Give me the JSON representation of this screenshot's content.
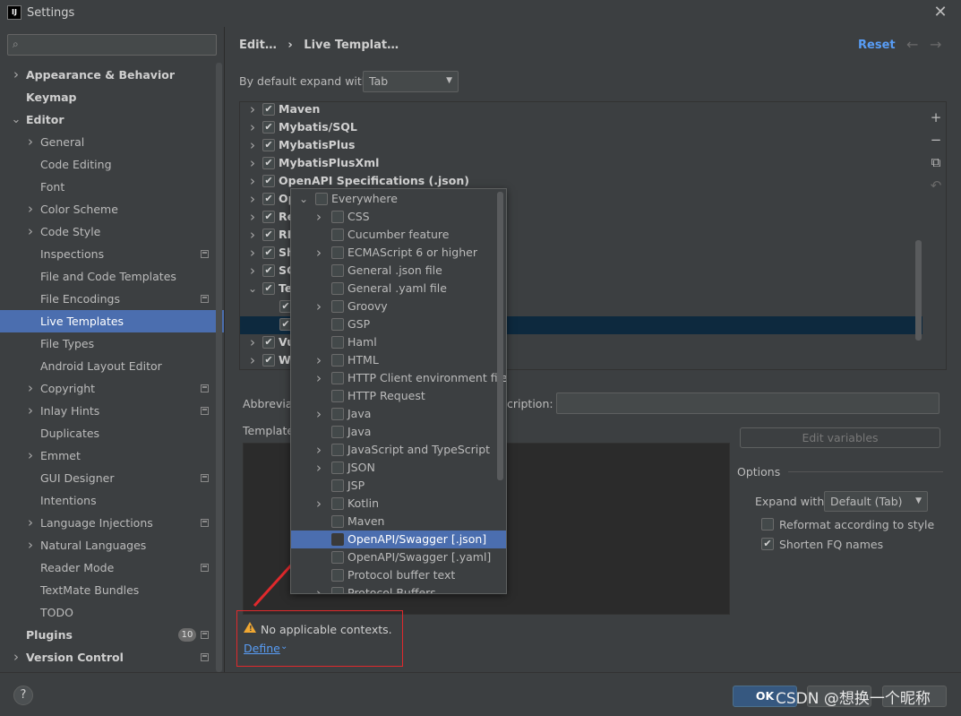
{
  "window": {
    "title": "Settings",
    "app_icon_text": "IJ"
  },
  "search": {
    "placeholder": "",
    "icon": "search-icon"
  },
  "sidebar": {
    "items": [
      {
        "label": "Appearance & Behavior",
        "level": 0,
        "bold": true,
        "chevron": "right"
      },
      {
        "label": "Keymap",
        "level": 0,
        "bold": true,
        "chevron": ""
      },
      {
        "label": "Editor",
        "level": 0,
        "bold": true,
        "chevron": "down"
      },
      {
        "label": "General",
        "level": 1,
        "chevron": "right"
      },
      {
        "label": "Code Editing",
        "level": 1,
        "chevron": ""
      },
      {
        "label": "Font",
        "level": 1,
        "chevron": ""
      },
      {
        "label": "Color Scheme",
        "level": 1,
        "chevron": "right"
      },
      {
        "label": "Code Style",
        "level": 1,
        "chevron": "right"
      },
      {
        "label": "Inspections",
        "level": 1,
        "chevron": "",
        "marker": true
      },
      {
        "label": "File and Code Templates",
        "level": 1,
        "chevron": ""
      },
      {
        "label": "File Encodings",
        "level": 1,
        "chevron": "",
        "marker": true
      },
      {
        "label": "Live Templates",
        "level": 1,
        "chevron": "",
        "selected": true
      },
      {
        "label": "File Types",
        "level": 1,
        "chevron": ""
      },
      {
        "label": "Android Layout Editor",
        "level": 1,
        "chevron": ""
      },
      {
        "label": "Copyright",
        "level": 1,
        "chevron": "right",
        "marker": true
      },
      {
        "label": "Inlay Hints",
        "level": 1,
        "chevron": "right",
        "marker": true
      },
      {
        "label": "Duplicates",
        "level": 1,
        "chevron": ""
      },
      {
        "label": "Emmet",
        "level": 1,
        "chevron": "right"
      },
      {
        "label": "GUI Designer",
        "level": 1,
        "chevron": "",
        "marker": true
      },
      {
        "label": "Intentions",
        "level": 1,
        "chevron": ""
      },
      {
        "label": "Language Injections",
        "level": 1,
        "chevron": "right",
        "marker": true
      },
      {
        "label": "Natural Languages",
        "level": 1,
        "chevron": "right"
      },
      {
        "label": "Reader Mode",
        "level": 1,
        "chevron": "",
        "marker": true
      },
      {
        "label": "TextMate Bundles",
        "level": 1,
        "chevron": ""
      },
      {
        "label": "TODO",
        "level": 1,
        "chevron": ""
      },
      {
        "label": "Plugins",
        "level": 0,
        "bold": true,
        "chevron": "",
        "badge": "10",
        "marker": true
      },
      {
        "label": "Version Control",
        "level": 0,
        "bold": true,
        "chevron": "right",
        "marker": true
      }
    ]
  },
  "header": {
    "breadcrumb_1": "Edit…",
    "breadcrumb_sep": "›",
    "breadcrumb_2": "Live Templat…",
    "reset": "Reset",
    "back_arrow": "←",
    "forward_arrow": "→"
  },
  "expand": {
    "label": "By default expand with",
    "value": "Tab"
  },
  "template_groups": [
    {
      "label": "Maven",
      "checked": true,
      "chevron": "right"
    },
    {
      "label": "Mybatis/SQL",
      "checked": true,
      "chevron": "right"
    },
    {
      "label": "MybatisPlus",
      "checked": true,
      "chevron": "right"
    },
    {
      "label": "MybatisPlusXml",
      "checked": true,
      "chevron": "right"
    },
    {
      "label": "OpenAPI Specifications (.json)",
      "checked": true,
      "chevron": "right"
    },
    {
      "label": "Op",
      "checked": true,
      "chevron": "right"
    },
    {
      "label": "Re",
      "checked": true,
      "chevron": "right"
    },
    {
      "label": "RE",
      "checked": true,
      "chevron": "right"
    },
    {
      "label": "Sh",
      "checked": true,
      "chevron": "right"
    },
    {
      "label": "SC",
      "checked": true,
      "chevron": "right"
    },
    {
      "label": "Te",
      "checked": true,
      "chevron": "down"
    },
    {
      "label": "",
      "checked": true,
      "chevron": "",
      "indent": true
    },
    {
      "label": "",
      "checked": true,
      "chevron": "",
      "indent": true,
      "selected": true
    },
    {
      "label": "Vu",
      "checked": true,
      "chevron": "right"
    },
    {
      "label": "W",
      "checked": true,
      "chevron": "right"
    }
  ],
  "tools": {
    "add": "+",
    "remove": "−",
    "copy": "⧉",
    "restore": "↶"
  },
  "form": {
    "abbreviation_label": "Abbreviat",
    "description_label": "cription:",
    "description_value": "",
    "template_text_label": "Template",
    "edit_variables": "Edit variables"
  },
  "options": {
    "title": "Options",
    "expand_with_label": "Expand with",
    "expand_with_value": "Default (Tab)",
    "reformat_label": "Reformat according to style",
    "reformat_checked": false,
    "shorten_label": "Shorten FQ names",
    "shorten_checked": true
  },
  "warning": {
    "text": "No applicable contexts.",
    "define_link": "Define",
    "define_chevron": "⌄"
  },
  "contexts_popup": {
    "items": [
      {
        "label": "Everywhere",
        "chevron": "down",
        "indent": 0
      },
      {
        "label": "CSS",
        "chevron": "right",
        "indent": 1
      },
      {
        "label": "Cucumber feature",
        "chevron": "",
        "indent": 1
      },
      {
        "label": "ECMAScript 6 or higher",
        "chevron": "right",
        "indent": 1
      },
      {
        "label": "General .json file",
        "chevron": "",
        "indent": 1
      },
      {
        "label": "General .yaml file",
        "chevron": "",
        "indent": 1
      },
      {
        "label": "Groovy",
        "chevron": "right",
        "indent": 1
      },
      {
        "label": "GSP",
        "chevron": "",
        "indent": 1
      },
      {
        "label": "Haml",
        "chevron": "",
        "indent": 1
      },
      {
        "label": "HTML",
        "chevron": "right",
        "indent": 1
      },
      {
        "label": "HTTP Client environment file",
        "chevron": "right",
        "indent": 1
      },
      {
        "label": "HTTP Request",
        "chevron": "",
        "indent": 1
      },
      {
        "label": "Java",
        "chevron": "right",
        "indent": 1
      },
      {
        "label": "Java",
        "chevron": "",
        "indent": 1
      },
      {
        "label": "JavaScript and TypeScript",
        "chevron": "right",
        "indent": 1
      },
      {
        "label": "JSON",
        "chevron": "right",
        "indent": 1
      },
      {
        "label": "JSP",
        "chevron": "",
        "indent": 1
      },
      {
        "label": "Kotlin",
        "chevron": "right",
        "indent": 1
      },
      {
        "label": "Maven",
        "chevron": "",
        "indent": 1
      },
      {
        "label": "OpenAPI/Swagger [.json]",
        "chevron": "",
        "indent": 1,
        "selected": true
      },
      {
        "label": "OpenAPI/Swagger [.yaml]",
        "chevron": "",
        "indent": 1
      },
      {
        "label": "Protocol buffer text",
        "chevron": "",
        "indent": 1
      },
      {
        "label": "Protocol Buffers",
        "chevron": "right",
        "indent": 1
      }
    ]
  },
  "footer": {
    "help": "?",
    "ok": "OK",
    "watermark": "CSDN @想换一个昵称"
  },
  "colors": {
    "background": "#3c3f41",
    "selection": "#4b6eaf",
    "link": "#589df6",
    "annotation_red": "#e0292c",
    "warning": "#f0a732"
  }
}
